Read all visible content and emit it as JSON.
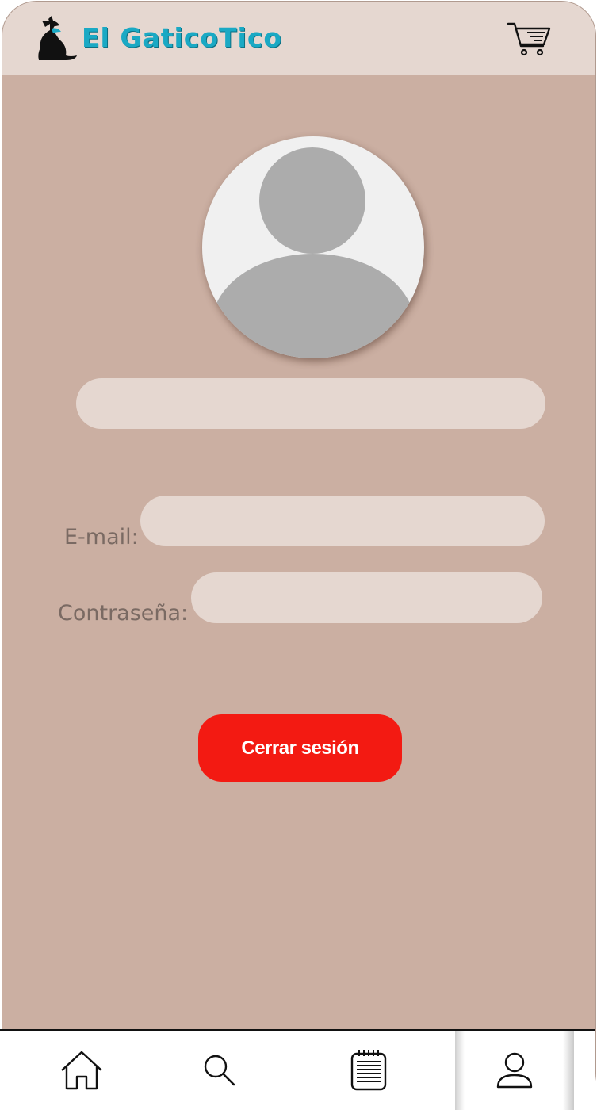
{
  "header": {
    "logo_text": "El GaticoTico",
    "logo_icon": "cat-logo-icon",
    "cart_icon": "shopping-cart-icon"
  },
  "profile": {
    "avatar_icon": "user-avatar-placeholder",
    "name_value": "",
    "email_label": "E-mail:",
    "email_value": "",
    "password_label": "Contraseña:",
    "password_value": "",
    "logout_label": "Cerrar sesión"
  },
  "bottom_nav": {
    "items": [
      {
        "icon": "home-icon",
        "active": false
      },
      {
        "icon": "search-icon",
        "active": false
      },
      {
        "icon": "menu-list-icon",
        "active": false
      },
      {
        "icon": "user-icon",
        "active": true
      }
    ]
  },
  "colors": {
    "background": "#cbafa2",
    "header": "#e5d7d0",
    "field": "#e5d7d0",
    "accent_logo": "#1aa9c4",
    "logout_button": "#f31a12"
  }
}
